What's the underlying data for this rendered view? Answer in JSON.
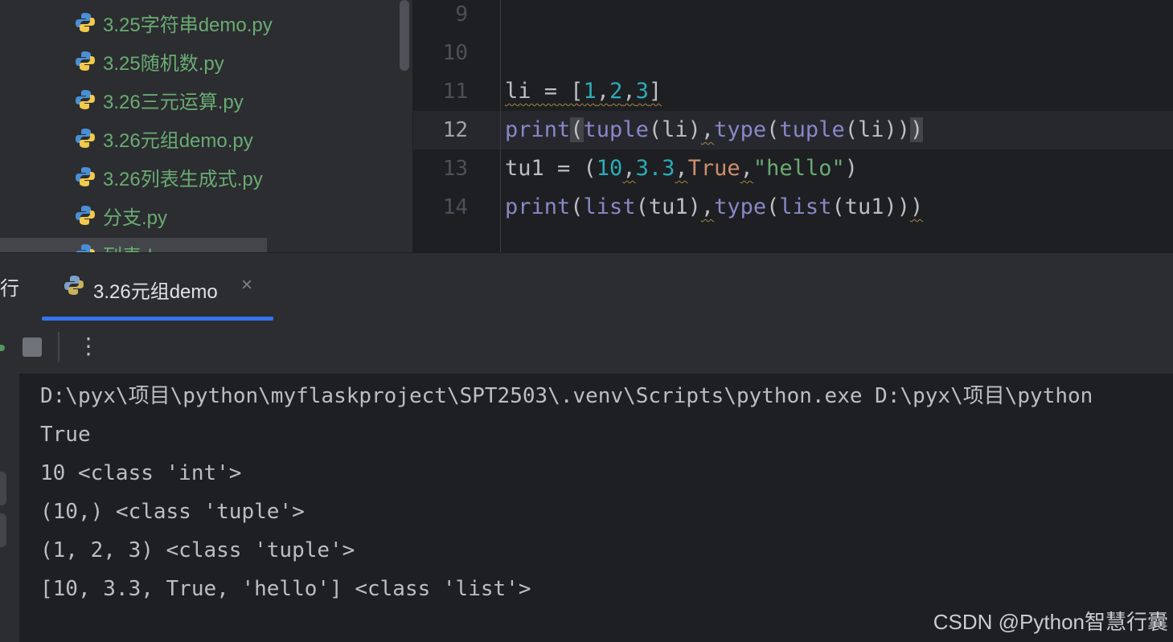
{
  "project_tree": {
    "files": [
      {
        "name": "3.25字符串demo.py",
        "icon": "python-file-icon"
      },
      {
        "name": "3.25随机数.py",
        "icon": "python-file-icon"
      },
      {
        "name": "3.26三元运算.py",
        "icon": "python-file-icon"
      },
      {
        "name": "3.26元组demo.py",
        "icon": "python-file-icon"
      },
      {
        "name": "3.26列表生成式.py",
        "icon": "python-file-icon"
      },
      {
        "name": "分支.py",
        "icon": "python-file-icon"
      },
      {
        "name": "列表demo.py",
        "icon": "python-file-icon"
      }
    ]
  },
  "editor": {
    "lines": [
      {
        "number": "9",
        "code": ""
      },
      {
        "number": "10",
        "code": ""
      },
      {
        "number": "11",
        "code": "li = [1,2,3]"
      },
      {
        "number": "12",
        "code": "print(tuple(li),type(tuple(li)))"
      },
      {
        "number": "13",
        "code": "tu1 = (10,3.3,True,\"hello\")"
      },
      {
        "number": "14",
        "code": "print(list(tu1),type(list(tu1)))"
      }
    ],
    "current_line": "12"
  },
  "run_panel": {
    "title": "行",
    "tab_label": "3.26元组demo",
    "tab_close": "×",
    "toolbar": {
      "rerun_icon": "rerun-icon",
      "stop_icon": "stop-icon",
      "more_icon": "⋮"
    },
    "console_output": [
      "D:\\pyx\\项目\\python\\myflaskproject\\SPT2503\\.venv\\Scripts\\python.exe D:\\pyx\\项目\\python",
      "True",
      "10 <class 'int'>",
      "(10,) <class 'tuple'>",
      "(1, 2, 3) <class 'tuple'>",
      "[10, 3.3, True, 'hello'] <class 'list'>"
    ]
  },
  "watermark": "CSDN @Python智慧行囊",
  "colors": {
    "background": "#1e1f22",
    "panel": "#2b2d30",
    "file_green": "#6aab73",
    "accent_blue": "#3574f0",
    "keyword_purple": "#8888c6",
    "number_cyan": "#2aacb8",
    "constant_orange": "#cf8e6d"
  }
}
